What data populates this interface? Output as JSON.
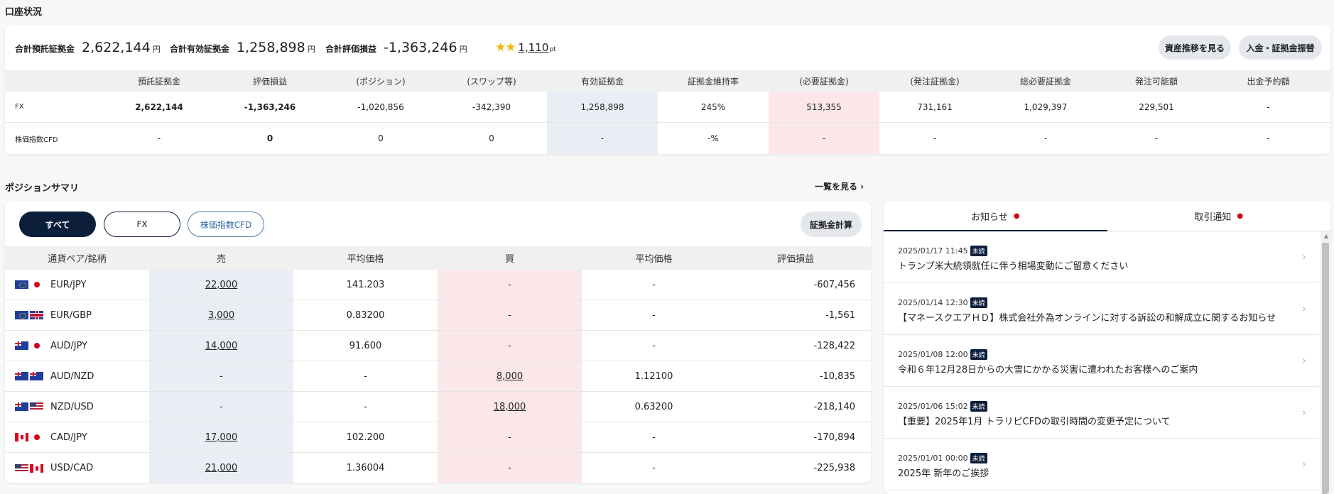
{
  "account": {
    "title": "口座状況",
    "stats": [
      {
        "label": "合計預託証拠金",
        "value": "2,622,144",
        "unit": "円"
      },
      {
        "label": "合計有効証拠金",
        "value": "1,258,898",
        "unit": "円"
      },
      {
        "label": "合計評価損益",
        "value": "-1,363,246",
        "unit": "円"
      }
    ],
    "points": {
      "value": "1,110",
      "unit": "pt"
    },
    "buttons": {
      "history": "資産推移を見る",
      "transfer": "入金・証拠金振替"
    },
    "headers": [
      "預託証拠金",
      "評価損益",
      "(ポジション)",
      "(スワップ等)",
      "有効証拠金",
      "証拠金維持率",
      "(必要証拠金)",
      "(発注証拠金)",
      "総必要証拠金",
      "発注可能額",
      "出金予約額"
    ],
    "rows": [
      {
        "label": "FX",
        "cells": [
          "2,622,144",
          "-1,363,246",
          "-1,020,856",
          "-342,390",
          "1,258,898",
          "245%",
          "513,355",
          "731,161",
          "1,029,397",
          "229,501",
          "-"
        ]
      },
      {
        "label": "株価指数CFD",
        "cells": [
          "-",
          "0",
          "0",
          "0",
          "-",
          "-%",
          "-",
          "-",
          "-",
          "-",
          "-"
        ]
      }
    ]
  },
  "positions": {
    "title": "ポジションサマリ",
    "view_all": "一覧を見る",
    "tabs": {
      "all": "すべて",
      "fx": "FX",
      "cfd": "株価指数CFD"
    },
    "calc_button": "証拠金計算",
    "headers": [
      "通貨ペア/銘柄",
      "売",
      "平均価格",
      "買",
      "平均価格",
      "評価損益"
    ],
    "rows": [
      {
        "pair": "EUR/JPY",
        "sell": "22,000",
        "sell_avg": "141.203",
        "buy": "-",
        "buy_avg": "-",
        "pl": "-607,456"
      },
      {
        "pair": "EUR/GBP",
        "sell": "3,000",
        "sell_avg": "0.83200",
        "buy": "-",
        "buy_avg": "-",
        "pl": "-1,561"
      },
      {
        "pair": "AUD/JPY",
        "sell": "14,000",
        "sell_avg": "91.600",
        "buy": "-",
        "buy_avg": "-",
        "pl": "-128,422"
      },
      {
        "pair": "AUD/NZD",
        "sell": "-",
        "sell_avg": "-",
        "buy": "8,000",
        "buy_avg": "1.12100",
        "pl": "-10,835"
      },
      {
        "pair": "NZD/USD",
        "sell": "-",
        "sell_avg": "-",
        "buy": "18,000",
        "buy_avg": "0.63200",
        "pl": "-218,140"
      },
      {
        "pair": "CAD/JPY",
        "sell": "17,000",
        "sell_avg": "102.200",
        "buy": "-",
        "buy_avg": "-",
        "pl": "-170,894"
      },
      {
        "pair": "USD/CAD",
        "sell": "21,000",
        "sell_avg": "1.36004",
        "buy": "-",
        "buy_avg": "-",
        "pl": "-225,938"
      }
    ]
  },
  "news": {
    "tabs": {
      "notices": "お知らせ",
      "trades": "取引通知"
    },
    "unread_label": "未読",
    "items": [
      {
        "date": "2025/01/17 11:45",
        "title": "トランプ米大統領就任に伴う相場変動にご留意ください"
      },
      {
        "date": "2025/01/14 12:30",
        "title": "【マネースクエアＨＤ】株式会社外為オンラインに対する訴訟の和解成立に関するお知らせ"
      },
      {
        "date": "2025/01/08 12:00",
        "title": "令和６年12月28日からの大雪にかかる災害に遭われたお客様へのご案内"
      },
      {
        "date": "2025/01/06 15:02",
        "title": "【重要】2025年1月 トラリピCFDの取引時間の変更予定について"
      },
      {
        "date": "2025/01/01 00:00",
        "title": "2025年 新年のご挨拶"
      }
    ]
  }
}
